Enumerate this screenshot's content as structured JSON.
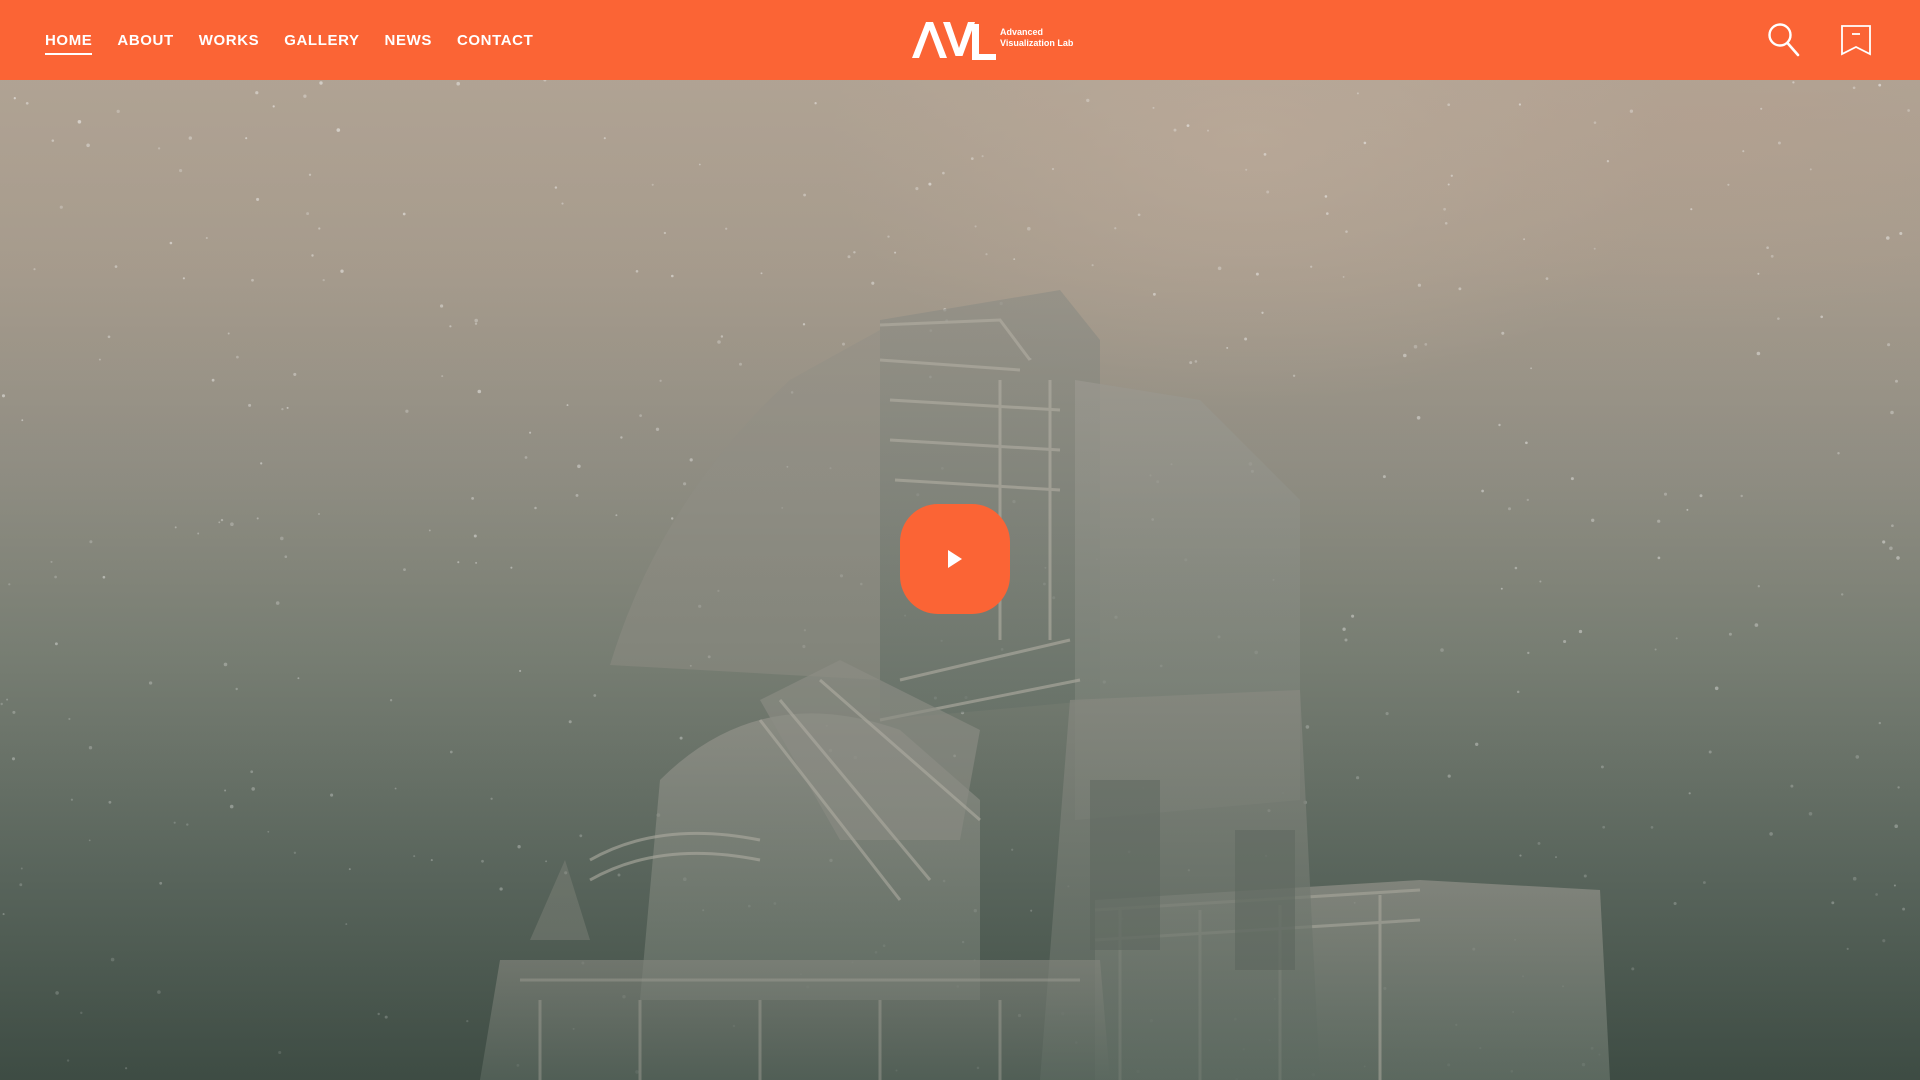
{
  "header": {
    "nav": [
      {
        "label": "HOME",
        "active": true
      },
      {
        "label": "ABOUT",
        "active": false
      },
      {
        "label": "WORKS",
        "active": false
      },
      {
        "label": "GALLERY",
        "active": false
      },
      {
        "label": "NEWS",
        "active": false
      },
      {
        "label": "CONTACT",
        "active": false
      }
    ],
    "logo": {
      "mark": "AVL",
      "line1": "Advanced",
      "line2": "Visualization Lab"
    },
    "icons": {
      "search": "search-icon",
      "bookmark": "bookmark-icon"
    },
    "background_color": "#fb6435"
  },
  "hero": {
    "scene": "telescope at night",
    "play_icon": "play-icon",
    "accent_color": "#fb6435"
  }
}
